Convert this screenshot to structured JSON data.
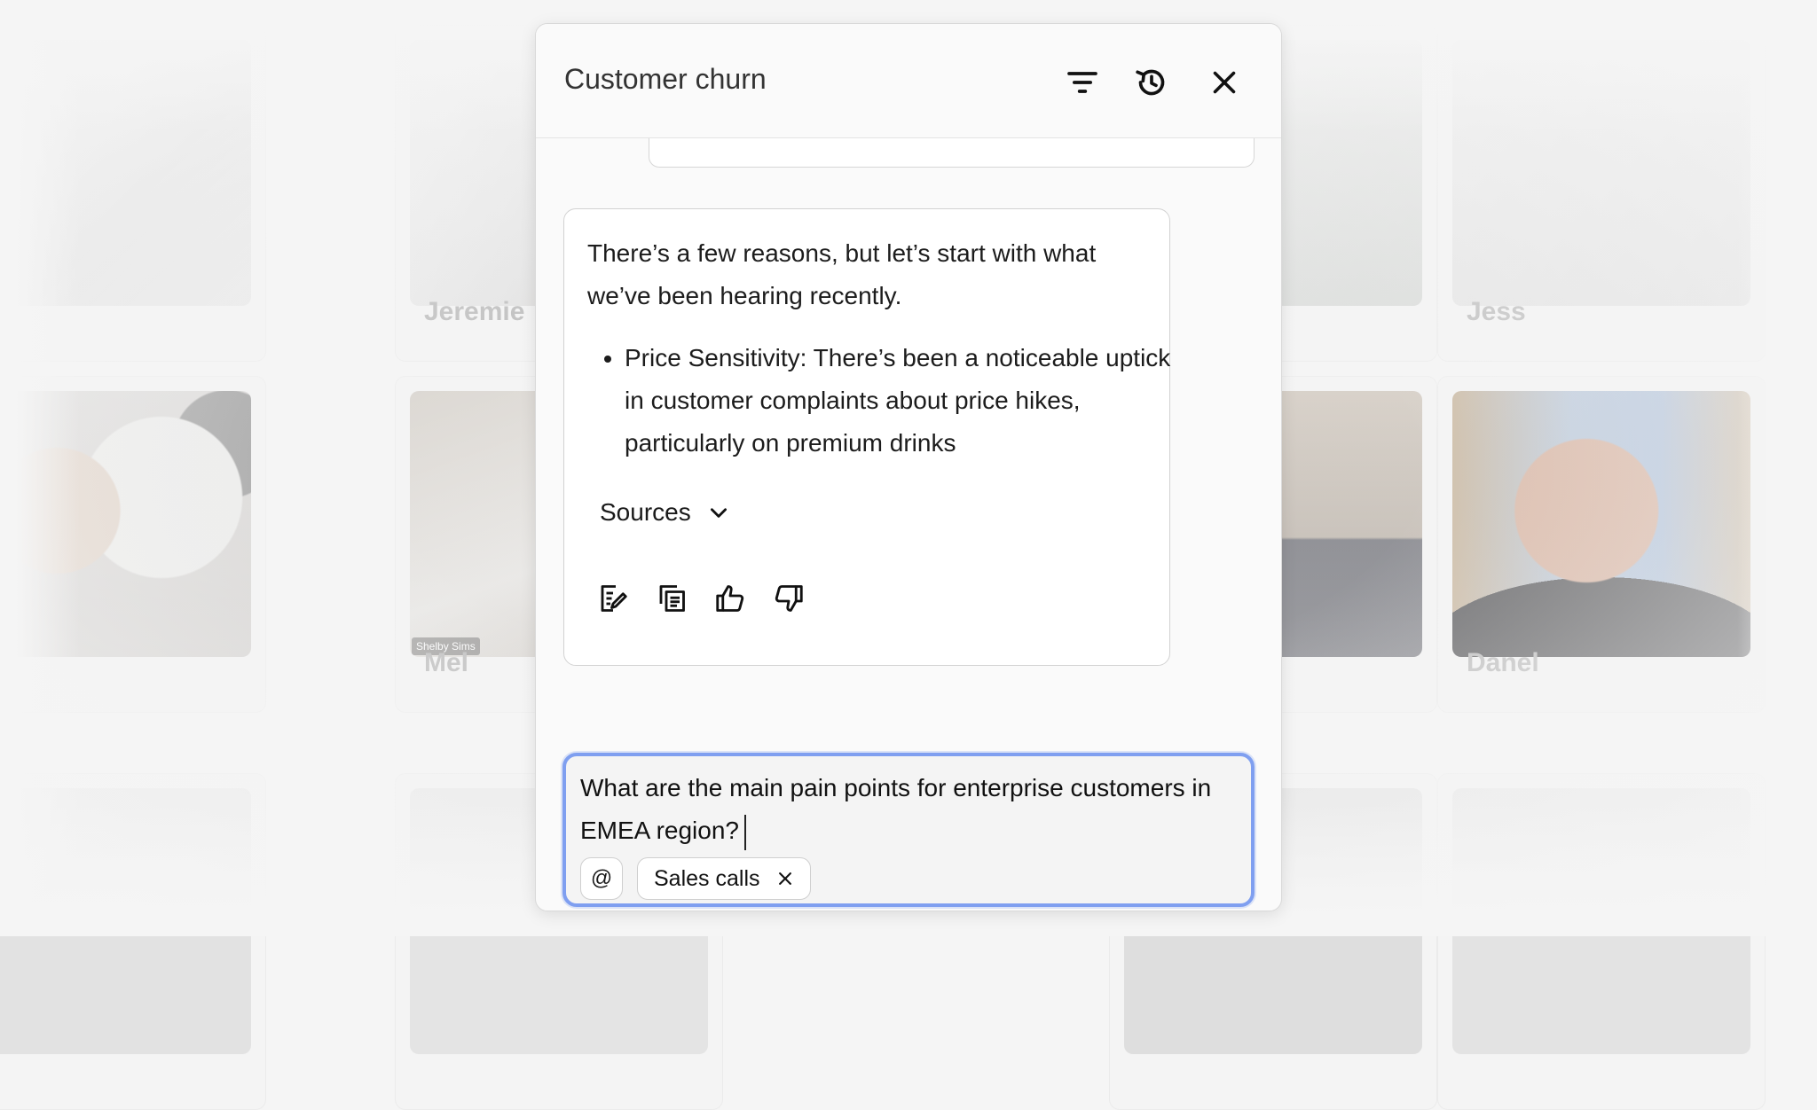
{
  "panel": {
    "title": "Customer churn",
    "icons": {
      "filter": "filter-icon",
      "history": "history-icon",
      "close": "close-icon"
    }
  },
  "answer": {
    "intro": "There’s a few reasons, but let’s start with what we’ve been hearing recently.",
    "bullets": [
      "Price Sensitivity: There’s been a noticeable uptick in customer complaints about price hikes, particularly on premium drinks"
    ],
    "sources_label": "Sources",
    "actions": [
      "edit-note-icon",
      "copy-icon",
      "thumbs-up-icon",
      "thumbs-down-icon"
    ]
  },
  "composer": {
    "value": "What are the main pain points for enterprise customers in EMEA region?",
    "mention_symbol": "@",
    "chip_label": "Sales calls"
  },
  "participants": {
    "top_row": [
      "Jeremie",
      "Jess"
    ],
    "middle_row": [
      "Mel",
      "Danel"
    ],
    "video_tag": "Shelby Sims"
  },
  "colors": {
    "focus_ring": "#7f9ff0",
    "name_gray": "#a9a9a9"
  }
}
